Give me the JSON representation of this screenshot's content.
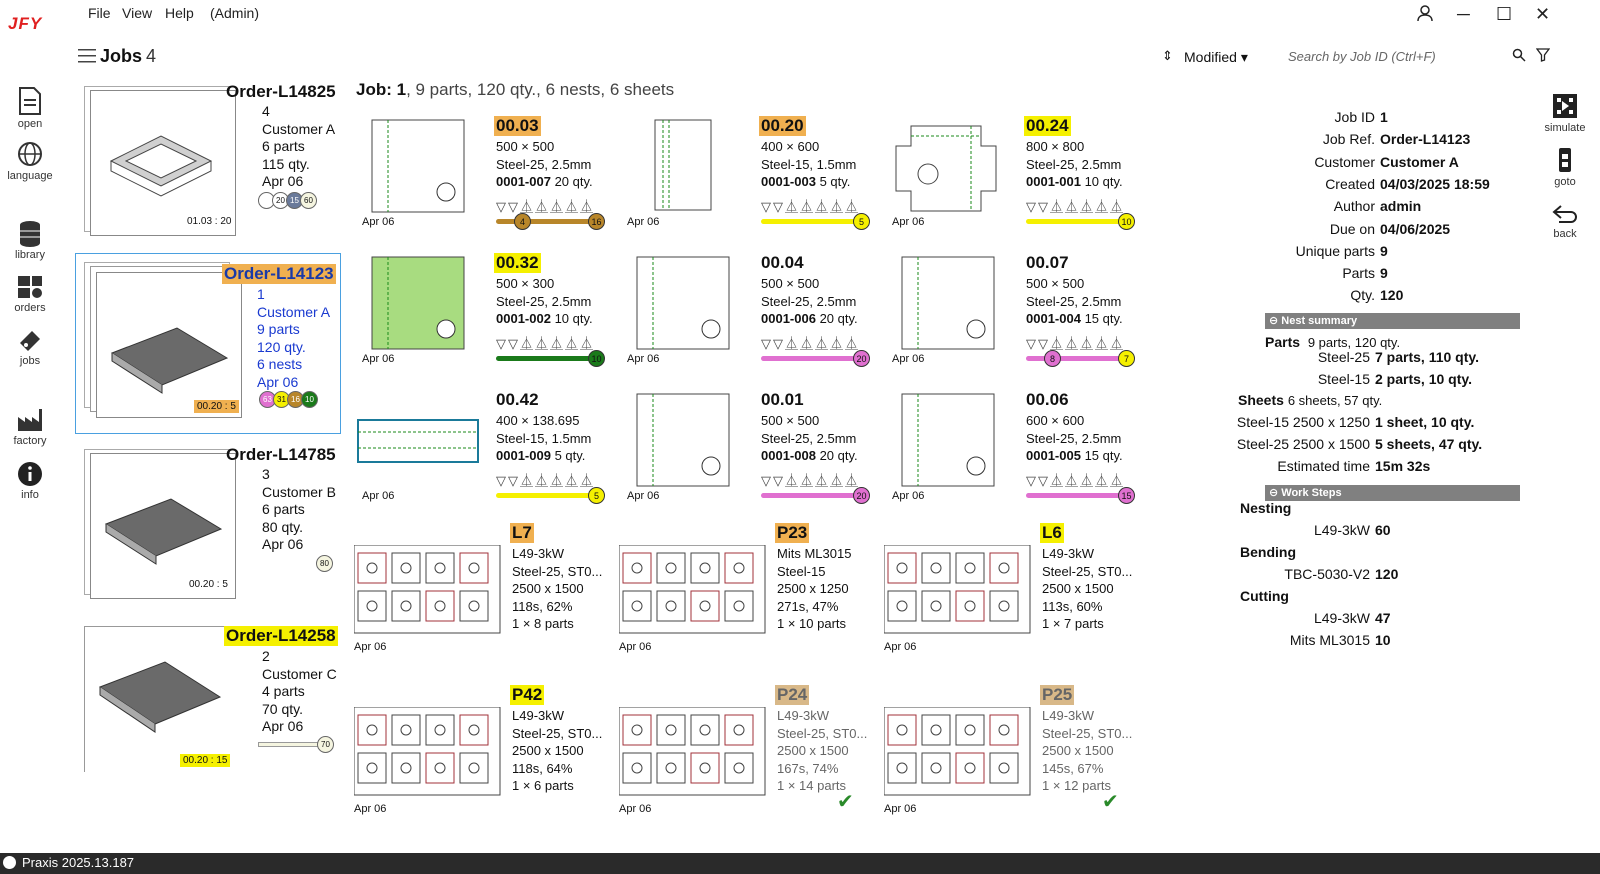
{
  "app": {
    "logo": "JFY",
    "menu": [
      "File",
      "View",
      "Help",
      "(Admin)"
    ],
    "status": "Praxis 2025.13.187"
  },
  "sidebar": {
    "items": [
      "open",
      "language",
      "library",
      "orders",
      "jobs",
      "factory",
      "info"
    ]
  },
  "rightbar": {
    "items": [
      "simulate",
      "goto",
      "back"
    ]
  },
  "header": {
    "title": "Jobs",
    "count": "4",
    "sort": "Modified",
    "search_placeholder": "Search by Job ID (Ctrl+F)"
  },
  "jobs": [
    {
      "name": "Order-L14825",
      "meta": [
        "4",
        "Customer A",
        "6 parts",
        "115 qty.",
        "Apr 06"
      ],
      "timer": "01.03 : 20",
      "badges": [
        "",
        "20",
        "15",
        "60"
      ]
    },
    {
      "name": "Order-L14123",
      "meta": [
        "1",
        "Customer A",
        "9 parts",
        "120 qty.",
        "6 nests",
        "Apr 06"
      ],
      "timer": "00.20 : 5",
      "badges": [
        "63",
        "31",
        "16",
        "10"
      ]
    },
    {
      "name": "Order-L14785",
      "meta": [
        "3",
        "Customer B",
        "6 parts",
        "80 qty.",
        "Apr 06"
      ],
      "timer": "00.20 : 5",
      "badges": [
        "80"
      ]
    },
    {
      "name": "Order-L14258",
      "meta": [
        "2",
        "Customer C",
        "4 parts",
        "70 qty.",
        "Apr 06"
      ],
      "timer": "00.20 : 15",
      "badges": [
        "70"
      ]
    }
  ],
  "job_header": {
    "label": "Job: 1",
    "rest": ", 9 parts, 120 qty., 6 nests, 6 sheets"
  },
  "parts": [
    {
      "id": "00.03",
      "size": "500 × 500",
      "mat": "Steel-25, 2.5mm",
      "num": "0001-007",
      "qty": "20 qty.",
      "date": "Apr 06",
      "tag": "#f0b050",
      "bar": "#b8862a",
      "dots": [
        "4",
        "16"
      ]
    },
    {
      "id": "00.20",
      "size": "400 × 600",
      "mat": "Steel-15, 1.5mm",
      "num": "0001-003",
      "qty": "5 qty.",
      "date": "Apr 06",
      "tag": "#f0b050",
      "bar": "#f5f000",
      "dots": [
        "5"
      ]
    },
    {
      "id": "00.24",
      "size": "800 × 800",
      "mat": "Steel-25, 2.5mm",
      "num": "0001-001",
      "qty": "10 qty.",
      "date": "Apr 06",
      "tag": "#f5f000",
      "bar": "#f5f000",
      "dots": [
        "10"
      ]
    },
    {
      "id": "00.32",
      "size": "500 × 300",
      "mat": "Steel-25, 2.5mm",
      "num": "0001-002",
      "qty": "10 qty.",
      "date": "Apr 06",
      "tag": "#f5f000",
      "bar": "#1a7a1a",
      "dots": [
        "10"
      ]
    },
    {
      "id": "00.04",
      "size": "500 × 500",
      "mat": "Steel-25, 2.5mm",
      "num": "0001-006",
      "qty": "20 qty.",
      "date": "Apr 06",
      "tag": "",
      "bar": "#e070d0",
      "dots": [
        "20"
      ]
    },
    {
      "id": "00.07",
      "size": "500 × 500",
      "mat": "Steel-25, 2.5mm",
      "num": "0001-004",
      "qty": "15 qty.",
      "date": "Apr 06",
      "tag": "",
      "bar": "#e070d0",
      "dots": [
        "8",
        "7"
      ]
    },
    {
      "id": "00.42",
      "size": "400 × 138.695",
      "mat": "Steel-15, 1.5mm",
      "num": "0001-009",
      "qty": "5 qty.",
      "date": "Apr 06",
      "tag": "",
      "bar": "#f5f000",
      "dots": [
        "5"
      ]
    },
    {
      "id": "00.01",
      "size": "500 × 500",
      "mat": "Steel-25, 2.5mm",
      "num": "0001-008",
      "qty": "20 qty.",
      "date": "Apr 06",
      "tag": "",
      "bar": "#e070d0",
      "dots": [
        "20"
      ]
    },
    {
      "id": "00.06",
      "size": "600 × 600",
      "mat": "Steel-25, 2.5mm",
      "num": "0001-005",
      "qty": "15 qty.",
      "date": "Apr 06",
      "tag": "",
      "bar": "#e070d0",
      "dots": [
        "15"
      ]
    }
  ],
  "nests": [
    {
      "id": "L7",
      "lines": [
        "L49-3kW",
        "Steel-25, ST0...",
        "2500 x 1500",
        "118s, 62%",
        "1 × 8 parts"
      ],
      "date": "Apr 06",
      "tag": "#f0b050",
      "done": false
    },
    {
      "id": "P23",
      "lines": [
        "Mits ML3015",
        "Steel-15",
        "2500 x 1250",
        "271s, 47%",
        "1 × 10 parts"
      ],
      "date": "Apr 06",
      "tag": "#f0b050",
      "done": false
    },
    {
      "id": "L6",
      "lines": [
        "L49-3kW",
        "Steel-25, ST0...",
        "2500 x 1500",
        "113s, 60%",
        "1 × 7 parts"
      ],
      "date": "Apr 06",
      "tag": "#f5f000",
      "done": false
    },
    {
      "id": "P42",
      "lines": [
        "L49-3kW",
        "Steel-25, ST0...",
        "2500 x 1500",
        "118s, 64%",
        "1 × 6 parts"
      ],
      "date": "Apr 06",
      "tag": "#f5f000",
      "done": false
    },
    {
      "id": "P24",
      "lines": [
        "L49-3kW",
        "Steel-25, ST0...",
        "2500 x 1500",
        "167s, 74%",
        "1 × 14 parts"
      ],
      "date": "Apr 06",
      "tag": "#d8b888",
      "done": true
    },
    {
      "id": "P25",
      "lines": [
        "L49-3kW",
        "Steel-25, ST0...",
        "2500 x 1500",
        "145s, 67%",
        "1 × 12 parts"
      ],
      "date": "Apr 06",
      "tag": "#d8b888",
      "done": true
    }
  ],
  "details": [
    [
      "Job ID",
      "1"
    ],
    [
      "Job Ref.",
      "Order-L14123"
    ],
    [
      "Customer",
      "Customer A"
    ],
    [
      "Created",
      "04/03/2025 18:59"
    ],
    [
      "Author",
      "admin"
    ],
    [
      "Due on",
      "04/06/2025"
    ],
    [
      "Unique parts",
      "9"
    ],
    [
      "Parts",
      "9"
    ],
    [
      "Qty.",
      "120"
    ]
  ],
  "nest_summary": {
    "title": "Nest summary",
    "parts_label": "Parts",
    "parts_value": "9 parts, 120 qty.",
    "parts_rows": [
      [
        "Steel-25",
        "7 parts, 110 qty."
      ],
      [
        "Steel-15",
        "2 parts, 10 qty."
      ]
    ],
    "sheets_label": "Sheets",
    "sheets_value": "6 sheets, 57 qty.",
    "sheets_rows": [
      [
        "Steel-15 2500 x 1250",
        "1 sheet, 10 qty."
      ],
      [
        "Steel-25 2500 x 1500",
        "5 sheets, 47 qty."
      ],
      [
        "Estimated time",
        "15m 32s"
      ]
    ]
  },
  "work_steps": {
    "title": "Work Steps",
    "groups": [
      {
        "name": "Nesting",
        "rows": [
          [
            "L49-3kW",
            "60"
          ]
        ]
      },
      {
        "name": "Bending",
        "rows": [
          [
            "TBC-5030-V2",
            "120"
          ]
        ]
      },
      {
        "name": "Cutting",
        "rows": [
          [
            "L49-3kW",
            "47"
          ],
          [
            "Mits ML3015",
            "10"
          ]
        ]
      }
    ]
  }
}
